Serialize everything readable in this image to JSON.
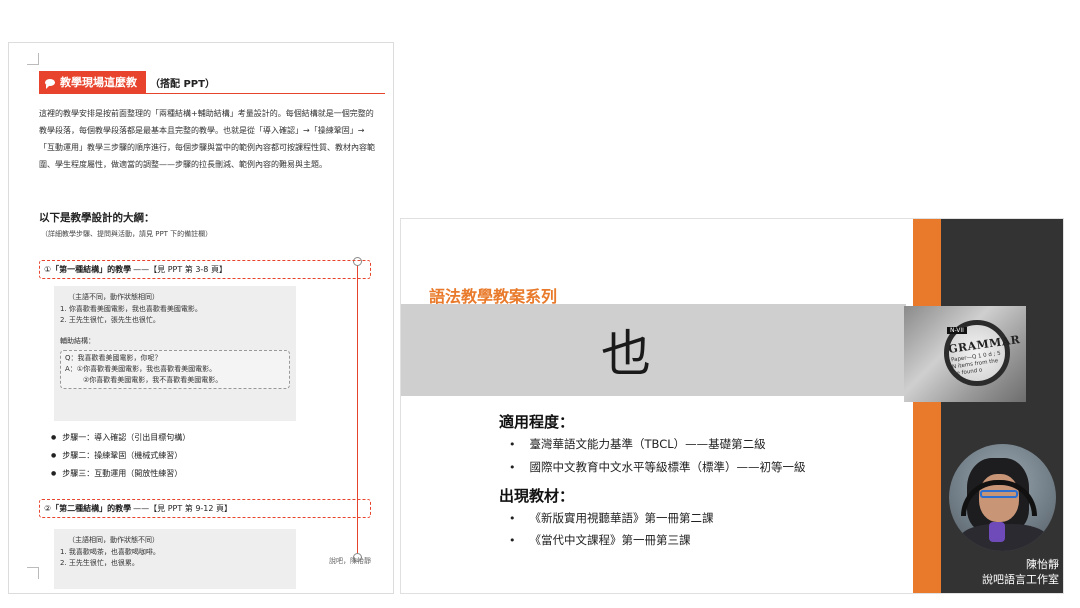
{
  "doc": {
    "header_label": "教學現場這麼教",
    "header_sub": "（搭配 PPT）",
    "paragraph": "這裡的教學安排是按前面整理的「兩種結構+輔助結構」考量設計的。每個結構就是一個完整的教學段落，每個教學段落都是最基本且完整的教學。也就是從「導入確認」→「操練鞏固」→「互動運用」教學三步驟的順序進行，每個步驟與當中的範例內容都可按課程性質、教材內容範圍、學生程度屬性，做適當的調整——步驟的拉長刪減、範例內容的難易與主題。",
    "outline_title": "以下是教學設計的大綱：",
    "outline_note": "（詳細教學步驟、提問與活動，請見 PPT 下的備註欄）",
    "section1": {
      "num": "①",
      "title": "「第一種結構」的教學",
      "ref": "——【見 PPT 第 3-8 頁】"
    },
    "box1": {
      "heading": "（主語不同，動作狀態相同）",
      "lines": [
        "1. 你喜歡看美國電影，我也喜歡看美國電影。",
        "2. 王先生很忙，張先生也很忙。"
      ],
      "aux_label": "輔助結構：",
      "q": "Q：我喜歡看美國電影，你呢？",
      "a1": "A：①你喜歡看美國電影，我也喜歡看美國電影。",
      "a2": "②你喜歡看美國電影，我不喜歡看美國電影。"
    },
    "bullets": [
      "步驟一：導入確認（引出目標句構）",
      "步驟二：操練鞏固（機械式練習）",
      "步驟三：互動運用（開放性練習）"
    ],
    "section2": {
      "num": "②",
      "title": "「第二種結構」的教學",
      "ref": "——【見 PPT 第 9-12 頁】"
    },
    "box2": {
      "heading": "（主語相同，動作狀態不同）",
      "lines": [
        "1. 我喜歡喝茶，也喜歡喝咖啡。",
        "2. 王先生很忙，也很累。"
      ]
    },
    "footer": "說吧，陳怡靜"
  },
  "slide": {
    "series": "語法教學教案系列",
    "character": "也",
    "h1": "適用程度：",
    "levels": [
      "臺灣華語文能力基準（TBCL）——基礎第二級",
      "國際中文教育中文水平等級標準（標準）——初等一級"
    ],
    "h2": "出現教材：",
    "materials": [
      "《新版實用視聽華語》第一冊第二課",
      "《當代中文課程》第一冊第三課"
    ],
    "image_tag": "N-VII",
    "image_word": "GRAMMAR",
    "image_small": "Paper—Q 1 0 d ; 5\nN items from the\nhe found o",
    "presenter_name": "陳怡靜",
    "presenter_studio": "說吧語言工作室"
  },
  "colors": {
    "accent_red": "#e8442d",
    "accent_orange": "#e97a2b",
    "dark_panel": "#333333"
  }
}
